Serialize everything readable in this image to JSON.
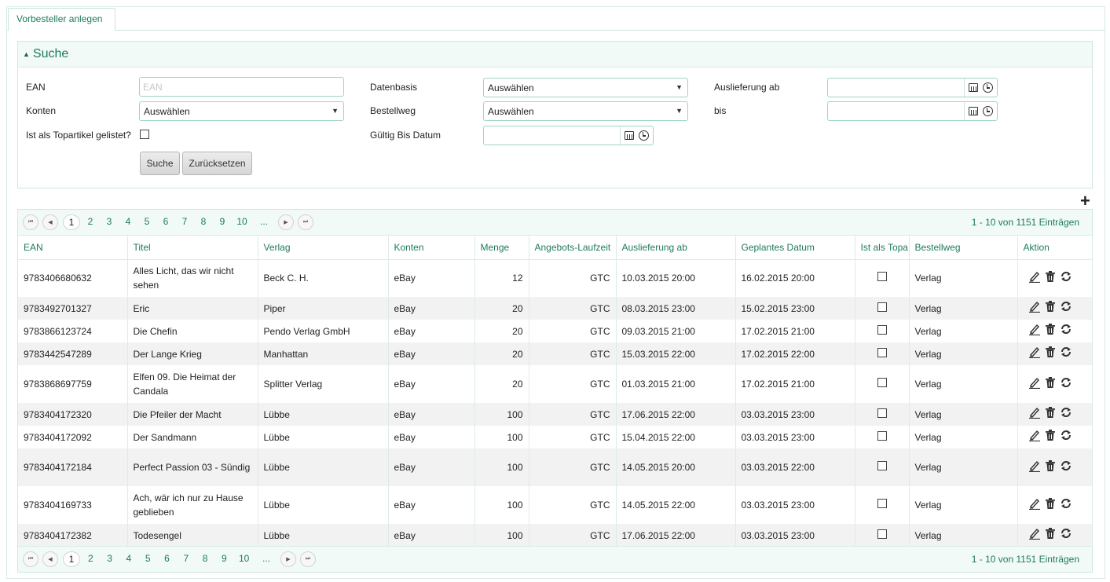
{
  "tab": {
    "label": "Vorbesteller anlegen"
  },
  "search": {
    "title": "Suche",
    "ean_label": "EAN",
    "ean_placeholder": "EAN",
    "konten_label": "Konten",
    "konten_value": "Auswählen",
    "topartikel_label": "Ist als Topartikel gelistet?",
    "datenbasis_label": "Datenbasis",
    "datenbasis_value": "Auswählen",
    "bestellweg_label": "Bestellweg",
    "bestellweg_value": "Auswählen",
    "gueltig_label": "Gültig Bis Datum",
    "auslieferung_label": "Auslieferung ab",
    "bis_label": "bis",
    "search_button": "Suche",
    "reset_button": "Zurücksetzen"
  },
  "pager": {
    "pages": [
      "1",
      "2",
      "3",
      "4",
      "5",
      "6",
      "7",
      "8",
      "9",
      "10",
      "..."
    ],
    "info": "1 - 10 von 1151 Einträgen"
  },
  "columns": [
    "EAN",
    "Titel",
    "Verlag",
    "Konten",
    "Menge",
    "Angebots-Laufzeit",
    "Auslieferung ab",
    "Geplantes Datum",
    "Ist als Topa",
    "Bestellweg",
    "Aktion"
  ],
  "rows": [
    {
      "ean": "9783406680632",
      "titel": "Alles Licht, das wir nicht sehen",
      "verlag": "Beck C. H.",
      "konten": "eBay",
      "menge": "12",
      "laufzeit": "GTC",
      "auslieferung": "10.03.2015 20:00",
      "geplant": "16.02.2015 20:00",
      "bestellweg": "Verlag"
    },
    {
      "ean": "9783492701327",
      "titel": "Eric",
      "verlag": "Piper",
      "konten": "eBay",
      "menge": "20",
      "laufzeit": "GTC",
      "auslieferung": "08.03.2015 23:00",
      "geplant": "15.02.2015 23:00",
      "bestellweg": "Verlag"
    },
    {
      "ean": "9783866123724",
      "titel": "Die Chefin",
      "verlag": "Pendo Verlag GmbH",
      "konten": "eBay",
      "menge": "20",
      "laufzeit": "GTC",
      "auslieferung": "09.03.2015 21:00",
      "geplant": "17.02.2015 21:00",
      "bestellweg": "Verlag"
    },
    {
      "ean": "9783442547289",
      "titel": "Der Lange Krieg",
      "verlag": "Manhattan",
      "konten": "eBay",
      "menge": "20",
      "laufzeit": "GTC",
      "auslieferung": "15.03.2015 22:00",
      "geplant": "17.02.2015 22:00",
      "bestellweg": "Verlag"
    },
    {
      "ean": "9783868697759",
      "titel": "Elfen 09. Die Heimat der Candala",
      "verlag": "Splitter Verlag",
      "konten": "eBay",
      "menge": "20",
      "laufzeit": "GTC",
      "auslieferung": "01.03.2015 21:00",
      "geplant": "17.02.2015 21:00",
      "bestellweg": "Verlag"
    },
    {
      "ean": "9783404172320",
      "titel": "Die Pfeiler der Macht",
      "verlag": "Lübbe",
      "konten": "eBay",
      "menge": "100",
      "laufzeit": "GTC",
      "auslieferung": "17.06.2015 22:00",
      "geplant": "03.03.2015 23:00",
      "bestellweg": "Verlag"
    },
    {
      "ean": "9783404172092",
      "titel": "Der Sandmann",
      "verlag": "Lübbe",
      "konten": "eBay",
      "menge": "100",
      "laufzeit": "GTC",
      "auslieferung": "15.04.2015 22:00",
      "geplant": "03.03.2015 23:00",
      "bestellweg": "Verlag"
    },
    {
      "ean": "9783404172184",
      "titel": "Perfect Passion 03 - Sündig",
      "verlag": "Lübbe",
      "konten": "eBay",
      "menge": "100",
      "laufzeit": "GTC",
      "auslieferung": "14.05.2015 20:00",
      "geplant": "03.03.2015 22:00",
      "bestellweg": "Verlag"
    },
    {
      "ean": "9783404169733",
      "titel": "Ach, wär ich nur zu Hause geblieben",
      "verlag": "Lübbe",
      "konten": "eBay",
      "menge": "100",
      "laufzeit": "GTC",
      "auslieferung": "14.05.2015 22:00",
      "geplant": "03.03.2015 23:00",
      "bestellweg": "Verlag"
    },
    {
      "ean": "9783404172382",
      "titel": "Todesengel",
      "verlag": "Lübbe",
      "konten": "eBay",
      "menge": "100",
      "laufzeit": "GTC",
      "auslieferung": "17.06.2015 22:00",
      "geplant": "03.03.2015 23:00",
      "bestellweg": "Verlag"
    }
  ],
  "icons": {
    "edit": "edit-icon",
    "delete": "trash-icon",
    "refresh": "refresh-icon",
    "add": "plus-icon",
    "calendar": "calendar-icon",
    "clock": "clock-icon"
  },
  "colors": {
    "accent": "#1e7a5f",
    "border": "#9fd5c2",
    "header_bg": "#f1faf6"
  }
}
